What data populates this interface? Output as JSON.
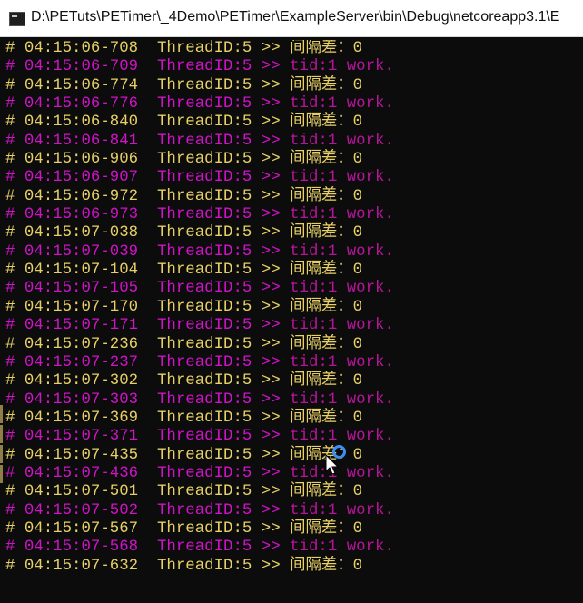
{
  "window": {
    "title": "D:\\PETuts\\PETimer\\_4Demo\\PETimer\\ExampleServer\\bin\\Debug\\netcoreapp3.1\\E"
  },
  "colors": {
    "background": "#0c0c0c",
    "yellow": "#e7d066",
    "magenta": "#d012c8"
  },
  "lines": [
    {
      "ts": "# 04:15:06-708",
      "tid": "ThreadID:5",
      "sep": ">>",
      "msg": "间隔差：0"
    },
    {
      "ts": "# 04:15:06-709",
      "tid": "ThreadID:5",
      "sep": ">>",
      "msg": "tid:1 work."
    },
    {
      "ts": "# 04:15:06-774",
      "tid": "ThreadID:5",
      "sep": ">>",
      "msg": "间隔差：0"
    },
    {
      "ts": "# 04:15:06-776",
      "tid": "ThreadID:5",
      "sep": ">>",
      "msg": "tid:1 work."
    },
    {
      "ts": "# 04:15:06-840",
      "tid": "ThreadID:5",
      "sep": ">>",
      "msg": "间隔差：0"
    },
    {
      "ts": "# 04:15:06-841",
      "tid": "ThreadID:5",
      "sep": ">>",
      "msg": "tid:1 work."
    },
    {
      "ts": "# 04:15:06-906",
      "tid": "ThreadID:5",
      "sep": ">>",
      "msg": "间隔差：0"
    },
    {
      "ts": "# 04:15:06-907",
      "tid": "ThreadID:5",
      "sep": ">>",
      "msg": "tid:1 work."
    },
    {
      "ts": "# 04:15:06-972",
      "tid": "ThreadID:5",
      "sep": ">>",
      "msg": "间隔差：0"
    },
    {
      "ts": "# 04:15:06-973",
      "tid": "ThreadID:5",
      "sep": ">>",
      "msg": "tid:1 work."
    },
    {
      "ts": "# 04:15:07-038",
      "tid": "ThreadID:5",
      "sep": ">>",
      "msg": "间隔差：0"
    },
    {
      "ts": "# 04:15:07-039",
      "tid": "ThreadID:5",
      "sep": ">>",
      "msg": "tid:1 work."
    },
    {
      "ts": "# 04:15:07-104",
      "tid": "ThreadID:5",
      "sep": ">>",
      "msg": "间隔差：0"
    },
    {
      "ts": "# 04:15:07-105",
      "tid": "ThreadID:5",
      "sep": ">>",
      "msg": "tid:1 work."
    },
    {
      "ts": "# 04:15:07-170",
      "tid": "ThreadID:5",
      "sep": ">>",
      "msg": "间隔差：0"
    },
    {
      "ts": "# 04:15:07-171",
      "tid": "ThreadID:5",
      "sep": ">>",
      "msg": "tid:1 work."
    },
    {
      "ts": "# 04:15:07-236",
      "tid": "ThreadID:5",
      "sep": ">>",
      "msg": "间隔差：0"
    },
    {
      "ts": "# 04:15:07-237",
      "tid": "ThreadID:5",
      "sep": ">>",
      "msg": "tid:1 work."
    },
    {
      "ts": "# 04:15:07-302",
      "tid": "ThreadID:5",
      "sep": ">>",
      "msg": "间隔差：0"
    },
    {
      "ts": "# 04:15:07-303",
      "tid": "ThreadID:5",
      "sep": ">>",
      "msg": "tid:1 work."
    },
    {
      "ts": "# 04:15:07-369",
      "tid": "ThreadID:5",
      "sep": ">>",
      "msg": "间隔差：0"
    },
    {
      "ts": "# 04:15:07-371",
      "tid": "ThreadID:5",
      "sep": ">>",
      "msg": "tid:1 work."
    },
    {
      "ts": "# 04:15:07-435",
      "tid": "ThreadID:5",
      "sep": ">>",
      "msg": "间隔差：0"
    },
    {
      "ts": "# 04:15:07-436",
      "tid": "ThreadID:5",
      "sep": ">>",
      "msg": "tid:1 work."
    },
    {
      "ts": "# 04:15:07-501",
      "tid": "ThreadID:5",
      "sep": ">>",
      "msg": "间隔差：0"
    },
    {
      "ts": "# 04:15:07-502",
      "tid": "ThreadID:5",
      "sep": ">>",
      "msg": "tid:1 work."
    },
    {
      "ts": "# 04:15:07-567",
      "tid": "ThreadID:5",
      "sep": ">>",
      "msg": "间隔差：0"
    },
    {
      "ts": "# 04:15:07-568",
      "tid": "ThreadID:5",
      "sep": ">>",
      "msg": "tid:1 work."
    },
    {
      "ts": "# 04:15:07-632",
      "tid": "ThreadID:5",
      "sep": ">>",
      "msg": "间隔差：0"
    }
  ]
}
